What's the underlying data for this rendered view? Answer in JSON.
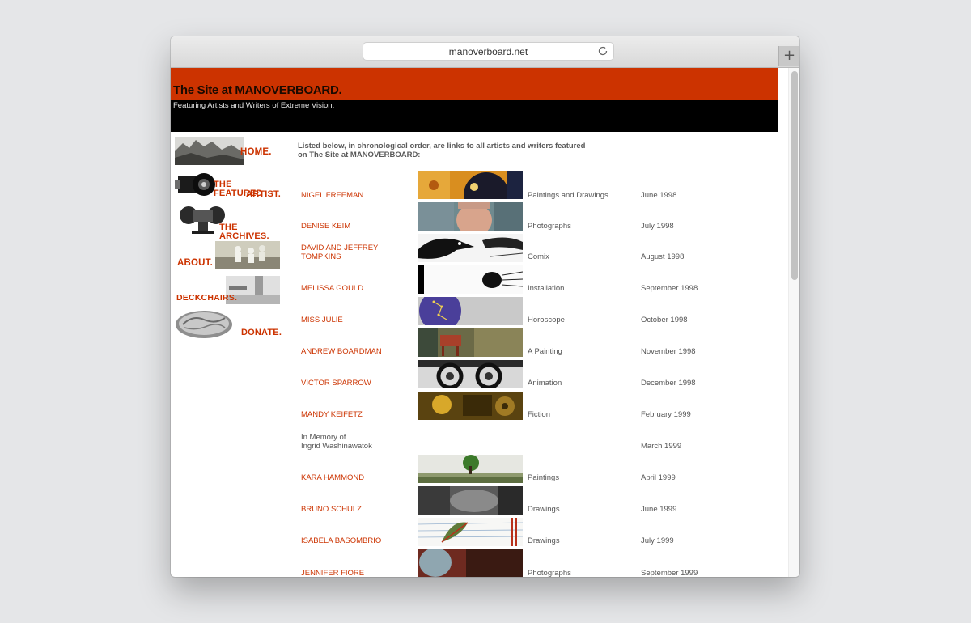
{
  "browser": {
    "url": "manoverboard.net",
    "newtab_symbol": "+"
  },
  "site": {
    "title": "The Site at MANOVERBOARD.",
    "tagline": "Featuring Artists and Writers of Extreme Vision.",
    "intro": "Listed below, in chronological order, are links to all artists and writers featured on The Site at MANOVERBOARD:"
  },
  "nav": [
    {
      "line1": "HOME.",
      "line2": ""
    },
    {
      "line1": "THE FEATURED",
      "line2": "ARTIST."
    },
    {
      "line1": "THE ARCHIVES.",
      "line2": ""
    },
    {
      "line1": "ABOUT.",
      "line2": ""
    },
    {
      "line1": "DECKCHAIRS.",
      "line2": ""
    },
    {
      "line1": "DONATE.",
      "line2": ""
    }
  ],
  "listing": [
    {
      "name": "NIGEL FREEMAN",
      "name2": "",
      "medium": "Paintings and Drawings",
      "date": "June 1998",
      "thumb": "painting-thumbnail"
    },
    {
      "name": "DENISE KEIM",
      "name2": "",
      "medium": "Photographs",
      "date": "July 1998",
      "thumb": "portrait-photo-thumbnail"
    },
    {
      "name": "DAVID AND JEFFREY",
      "name2": "TOMPKINS",
      "medium": "Comix",
      "date": "August 1998",
      "thumb": "comic-bird-thumbnail"
    },
    {
      "name": "MELISSA GOULD",
      "name2": "",
      "medium": "Installation",
      "date": "September 1998",
      "thumb": "installation-thumbnail"
    },
    {
      "name": "MISS JULIE",
      "name2": "",
      "medium": "Horoscope",
      "date": "October 1998",
      "thumb": "horoscope-thumbnail"
    },
    {
      "name": "ANDREW BOARDMAN",
      "name2": "",
      "medium": "A Painting",
      "date": "November 1998",
      "thumb": "red-chair-painting-thumbnail"
    },
    {
      "name": "VICTOR SPARROW",
      "name2": "",
      "medium": "Animation",
      "date": "December 1998",
      "thumb": "glasses-face-thumbnail"
    },
    {
      "name": "MANDY KEIFETZ",
      "name2": "",
      "medium": "Fiction",
      "date": "February 1999",
      "thumb": "fiction-thumbnail"
    },
    {
      "name": "In Memory of",
      "name2": "Ingrid Washinawatok",
      "medium": "",
      "date": "March 1999",
      "thumb": ""
    },
    {
      "name": "KARA HAMMOND",
      "name2": "",
      "medium": "Paintings",
      "date": "April 1999",
      "thumb": "landscape-tree-thumbnail"
    },
    {
      "name": "BRUNO SCHULZ",
      "name2": "",
      "medium": "Drawings",
      "date": "June 1999",
      "thumb": "dark-drawing-thumbnail"
    },
    {
      "name": "ISABELA BASOMBRIO",
      "name2": "",
      "medium": "Drawings",
      "date": "July 1999",
      "thumb": "leaf-drawing-thumbnail"
    },
    {
      "name": "JENNIFER FIORE",
      "name2": "",
      "medium": "Photographs",
      "date": "September 1999",
      "thumb": "photo-thumbnail"
    }
  ]
}
